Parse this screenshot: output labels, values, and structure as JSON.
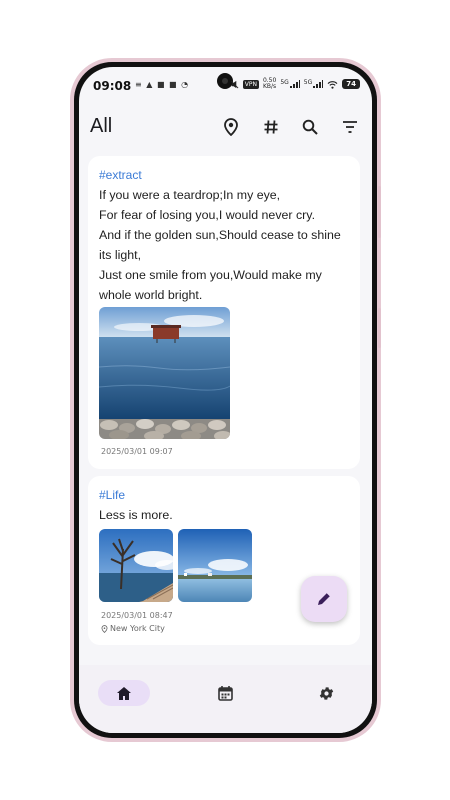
{
  "status_bar": {
    "time": "09:08",
    "left_icons": "≡ ▲ ■ ■ ◔",
    "vpn": "VPN",
    "speed_top": "0.50",
    "speed_bottom": "KB/s",
    "net1": "5G",
    "net2": "5G",
    "battery": "74"
  },
  "app_bar": {
    "title": "All",
    "actions": [
      "location-pin-icon",
      "hashtag-icon",
      "search-icon",
      "filter-icon"
    ]
  },
  "notes": [
    {
      "tag": "#extract",
      "lines": [
        "If you were a teardrop;In my eye,",
        "For fear of losing you,I would never cry.",
        "And if the golden sun,Should cease to shine",
        "its light,",
        "Just one smile from you,Would make my",
        "whole world bright."
      ],
      "timestamp": "2025/03/01 09:07"
    },
    {
      "tag": "#Life",
      "lines": [
        "Less is more."
      ],
      "timestamp": "2025/03/01 08:47",
      "location": "New York City"
    }
  ],
  "bottom_nav": [
    "home-icon",
    "calendar-icon",
    "settings-icon"
  ],
  "colors": {
    "accent": "#3b7bd6",
    "fab": "#ecdcf5",
    "nav_active": "#e9def7"
  }
}
